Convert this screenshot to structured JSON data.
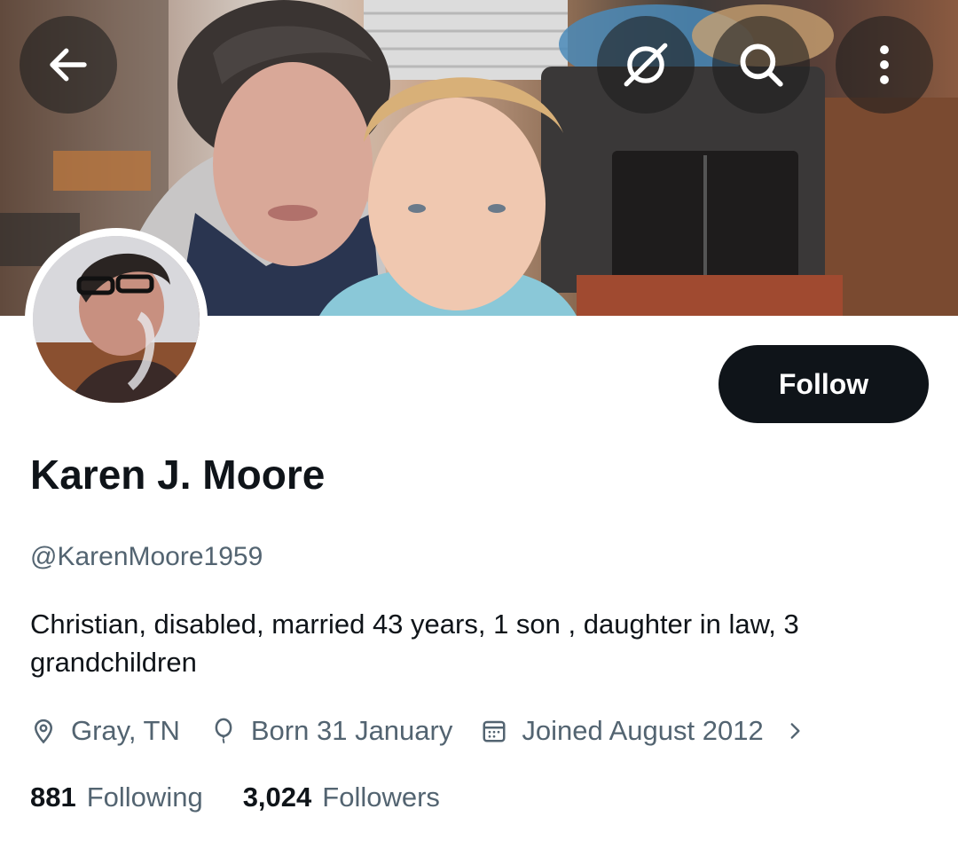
{
  "header": {
    "back": {
      "icon": "arrow-left-icon"
    },
    "actions": [
      {
        "name": "grok-icon"
      },
      {
        "name": "search-icon"
      },
      {
        "name": "more-vertical-icon"
      }
    ]
  },
  "profile": {
    "display_name": "Karen J. Moore",
    "handle": "@KarenMoore1959",
    "bio": "Christian, disabled, married 43 years, 1 son , daughter in law, 3 grandchildren",
    "location": "Gray, TN",
    "birthday": "Born 31 January",
    "joined": "Joined August 2012",
    "follow_label": "Follow"
  },
  "stats": {
    "following_count": "881",
    "following_label": "Following",
    "followers_count": "3,024",
    "followers_label": "Followers"
  },
  "colors": {
    "primary_text": "#0f1419",
    "secondary_text": "#536471",
    "button_bg": "#0f1419",
    "button_text": "#ffffff"
  }
}
